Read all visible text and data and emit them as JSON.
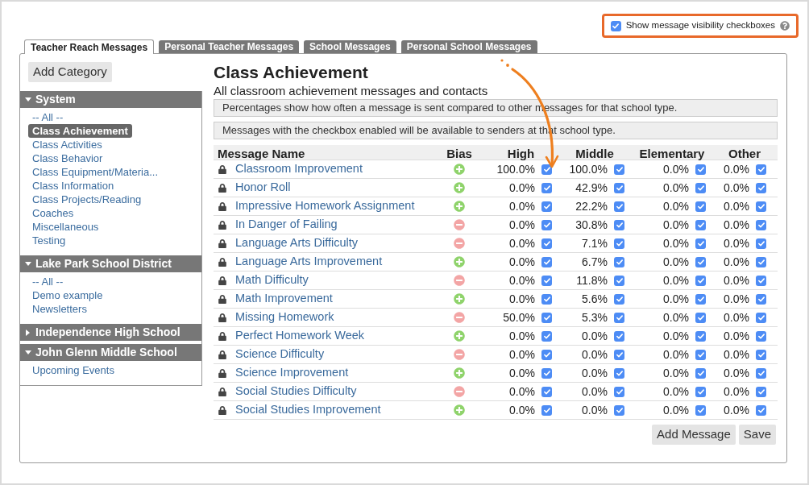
{
  "visibility_toggle": {
    "label": "Show message visibility checkboxes",
    "checked": true
  },
  "tabs": [
    {
      "label": "Teacher Reach Messages",
      "selected": true
    },
    {
      "label": "Personal Teacher Messages",
      "selected": false
    },
    {
      "label": "School Messages",
      "selected": false
    },
    {
      "label": "Personal School Messages",
      "selected": false
    }
  ],
  "sidebar": {
    "add_button": "Add Category",
    "groups": [
      {
        "title": "System",
        "expanded": true,
        "items": [
          {
            "label": "-- All --",
            "selected": false
          },
          {
            "label": "Class Achievement",
            "selected": true
          },
          {
            "label": "Class Activities",
            "selected": false
          },
          {
            "label": "Class Behavior",
            "selected": false
          },
          {
            "label": "Class Equipment/Materia...",
            "selected": false
          },
          {
            "label": "Class Information",
            "selected": false
          },
          {
            "label": "Class Projects/Reading",
            "selected": false
          },
          {
            "label": "Coaches",
            "selected": false
          },
          {
            "label": "Miscellaneous",
            "selected": false
          },
          {
            "label": "Testing",
            "selected": false
          }
        ]
      },
      {
        "title": "Lake Park School District",
        "expanded": true,
        "items": [
          {
            "label": "-- All --",
            "selected": false
          },
          {
            "label": "Demo example",
            "selected": false
          },
          {
            "label": "Newsletters",
            "selected": false
          }
        ]
      },
      {
        "title": "Independence High School",
        "expanded": false
      },
      {
        "title": "John Glenn Middle School",
        "expanded": true,
        "items": [
          {
            "label": "Upcoming Events",
            "selected": false
          }
        ]
      }
    ]
  },
  "content": {
    "title": "Class Achievement",
    "subtitle": "All classroom achievement messages and contacts",
    "notes": [
      "Percentages show how often a message is sent compared to other messages for that school type.",
      "Messages with the checkbox enabled will be available to senders at that school type."
    ],
    "table": {
      "columns": [
        "Message Name",
        "Bias",
        "High",
        "Middle",
        "Elementary",
        "Other"
      ],
      "rows": [
        {
          "cells": [
            {
              "text": "Classroom Improvement",
              "locked": true
            },
            {
              "kind": "positive"
            },
            {
              "text": "100.0%",
              "checked": true
            },
            {
              "text": "100.0%",
              "checked": true
            },
            {
              "text": "0.0%",
              "checked": true
            },
            {
              "text": "0.0%",
              "checked": true
            }
          ]
        },
        {
          "cells": [
            {
              "text": "Honor Roll",
              "locked": true
            },
            {
              "kind": "positive"
            },
            {
              "text": "0.0%",
              "checked": true
            },
            {
              "text": "42.9%",
              "checked": true
            },
            {
              "text": "0.0%",
              "checked": true
            },
            {
              "text": "0.0%",
              "checked": true
            }
          ]
        },
        {
          "cells": [
            {
              "text": "Impressive Homework Assignment",
              "locked": true
            },
            {
              "kind": "positive"
            },
            {
              "text": "0.0%",
              "checked": true
            },
            {
              "text": "22.2%",
              "checked": true
            },
            {
              "text": "0.0%",
              "checked": true
            },
            {
              "text": "0.0%",
              "checked": true
            }
          ]
        },
        {
          "cells": [
            {
              "text": "In Danger of Failing",
              "locked": true
            },
            {
              "kind": "negative"
            },
            {
              "text": "0.0%",
              "checked": true
            },
            {
              "text": "30.8%",
              "checked": true
            },
            {
              "text": "0.0%",
              "checked": true
            },
            {
              "text": "0.0%",
              "checked": true
            }
          ]
        },
        {
          "cells": [
            {
              "text": "Language Arts Difficulty",
              "locked": true
            },
            {
              "kind": "negative"
            },
            {
              "text": "0.0%",
              "checked": true
            },
            {
              "text": "7.1%",
              "checked": true
            },
            {
              "text": "0.0%",
              "checked": true
            },
            {
              "text": "0.0%",
              "checked": true
            }
          ]
        },
        {
          "cells": [
            {
              "text": "Language Arts Improvement",
              "locked": true
            },
            {
              "kind": "positive"
            },
            {
              "text": "0.0%",
              "checked": true
            },
            {
              "text": "6.7%",
              "checked": true
            },
            {
              "text": "0.0%",
              "checked": true
            },
            {
              "text": "0.0%",
              "checked": true
            }
          ]
        },
        {
          "cells": [
            {
              "text": "Math Difficulty",
              "locked": true
            },
            {
              "kind": "negative"
            },
            {
              "text": "0.0%",
              "checked": true
            },
            {
              "text": "11.8%",
              "checked": true
            },
            {
              "text": "0.0%",
              "checked": true
            },
            {
              "text": "0.0%",
              "checked": true
            }
          ]
        },
        {
          "cells": [
            {
              "text": "Math Improvement",
              "locked": true
            },
            {
              "kind": "positive"
            },
            {
              "text": "0.0%",
              "checked": true
            },
            {
              "text": "5.6%",
              "checked": true
            },
            {
              "text": "0.0%",
              "checked": true
            },
            {
              "text": "0.0%",
              "checked": true
            }
          ]
        },
        {
          "cells": [
            {
              "text": "Missing Homework",
              "locked": true
            },
            {
              "kind": "negative"
            },
            {
              "text": "50.0%",
              "checked": true
            },
            {
              "text": "5.3%",
              "checked": true
            },
            {
              "text": "0.0%",
              "checked": true
            },
            {
              "text": "0.0%",
              "checked": true
            }
          ]
        },
        {
          "cells": [
            {
              "text": "Perfect Homework Week",
              "locked": true
            },
            {
              "kind": "positive"
            },
            {
              "text": "0.0%",
              "checked": true
            },
            {
              "text": "0.0%",
              "checked": true
            },
            {
              "text": "0.0%",
              "checked": true
            },
            {
              "text": "0.0%",
              "checked": true
            }
          ]
        },
        {
          "cells": [
            {
              "text": "Science Difficulty",
              "locked": true
            },
            {
              "kind": "negative"
            },
            {
              "text": "0.0%",
              "checked": true
            },
            {
              "text": "0.0%",
              "checked": true
            },
            {
              "text": "0.0%",
              "checked": true
            },
            {
              "text": "0.0%",
              "checked": true
            }
          ]
        },
        {
          "cells": [
            {
              "text": "Science Improvement",
              "locked": true
            },
            {
              "kind": "positive"
            },
            {
              "text": "0.0%",
              "checked": true
            },
            {
              "text": "0.0%",
              "checked": true
            },
            {
              "text": "0.0%",
              "checked": true
            },
            {
              "text": "0.0%",
              "checked": true
            }
          ]
        },
        {
          "cells": [
            {
              "text": "Social Studies Difficulty",
              "locked": true
            },
            {
              "kind": "negative"
            },
            {
              "text": "0.0%",
              "checked": true
            },
            {
              "text": "0.0%",
              "checked": true
            },
            {
              "text": "0.0%",
              "checked": true
            },
            {
              "text": "0.0%",
              "checked": true
            }
          ]
        },
        {
          "cells": [
            {
              "text": "Social Studies Improvement",
              "locked": true
            },
            {
              "kind": "positive"
            },
            {
              "text": "0.0%",
              "checked": true
            },
            {
              "text": "0.0%",
              "checked": true
            },
            {
              "text": "0.0%",
              "checked": true
            },
            {
              "text": "0.0%",
              "checked": true
            }
          ]
        }
      ]
    },
    "buttons": [
      "Add Message",
      "Save"
    ]
  }
}
